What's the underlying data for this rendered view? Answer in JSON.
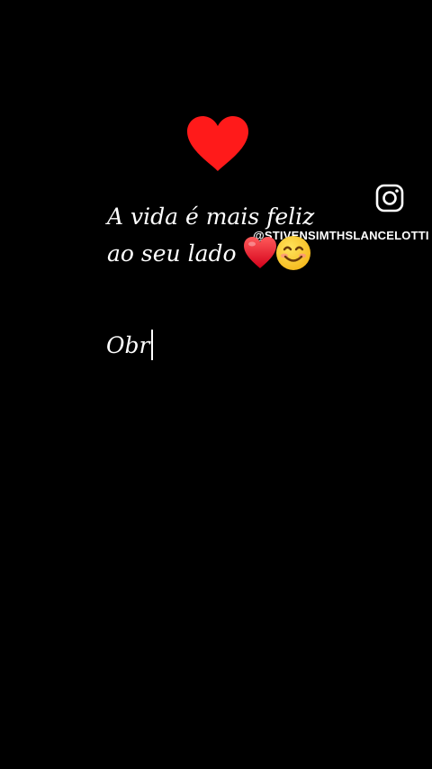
{
  "watermark": {
    "icon": "instagram-icon",
    "handle": "@STIVENSIMTHSLANCELOTTI"
  },
  "decoration": {
    "top_icon": "red-heart-icon"
  },
  "message": {
    "line1": "A vida é mais feliz",
    "line2": "ao seu lado",
    "emojis": [
      "heart-emoji-icon",
      "smiling-face-emoji-icon"
    ]
  },
  "typing_text": "Obr",
  "colors": {
    "background": "#000000",
    "text": "#ffffff",
    "heart": "#ff1a1a"
  }
}
